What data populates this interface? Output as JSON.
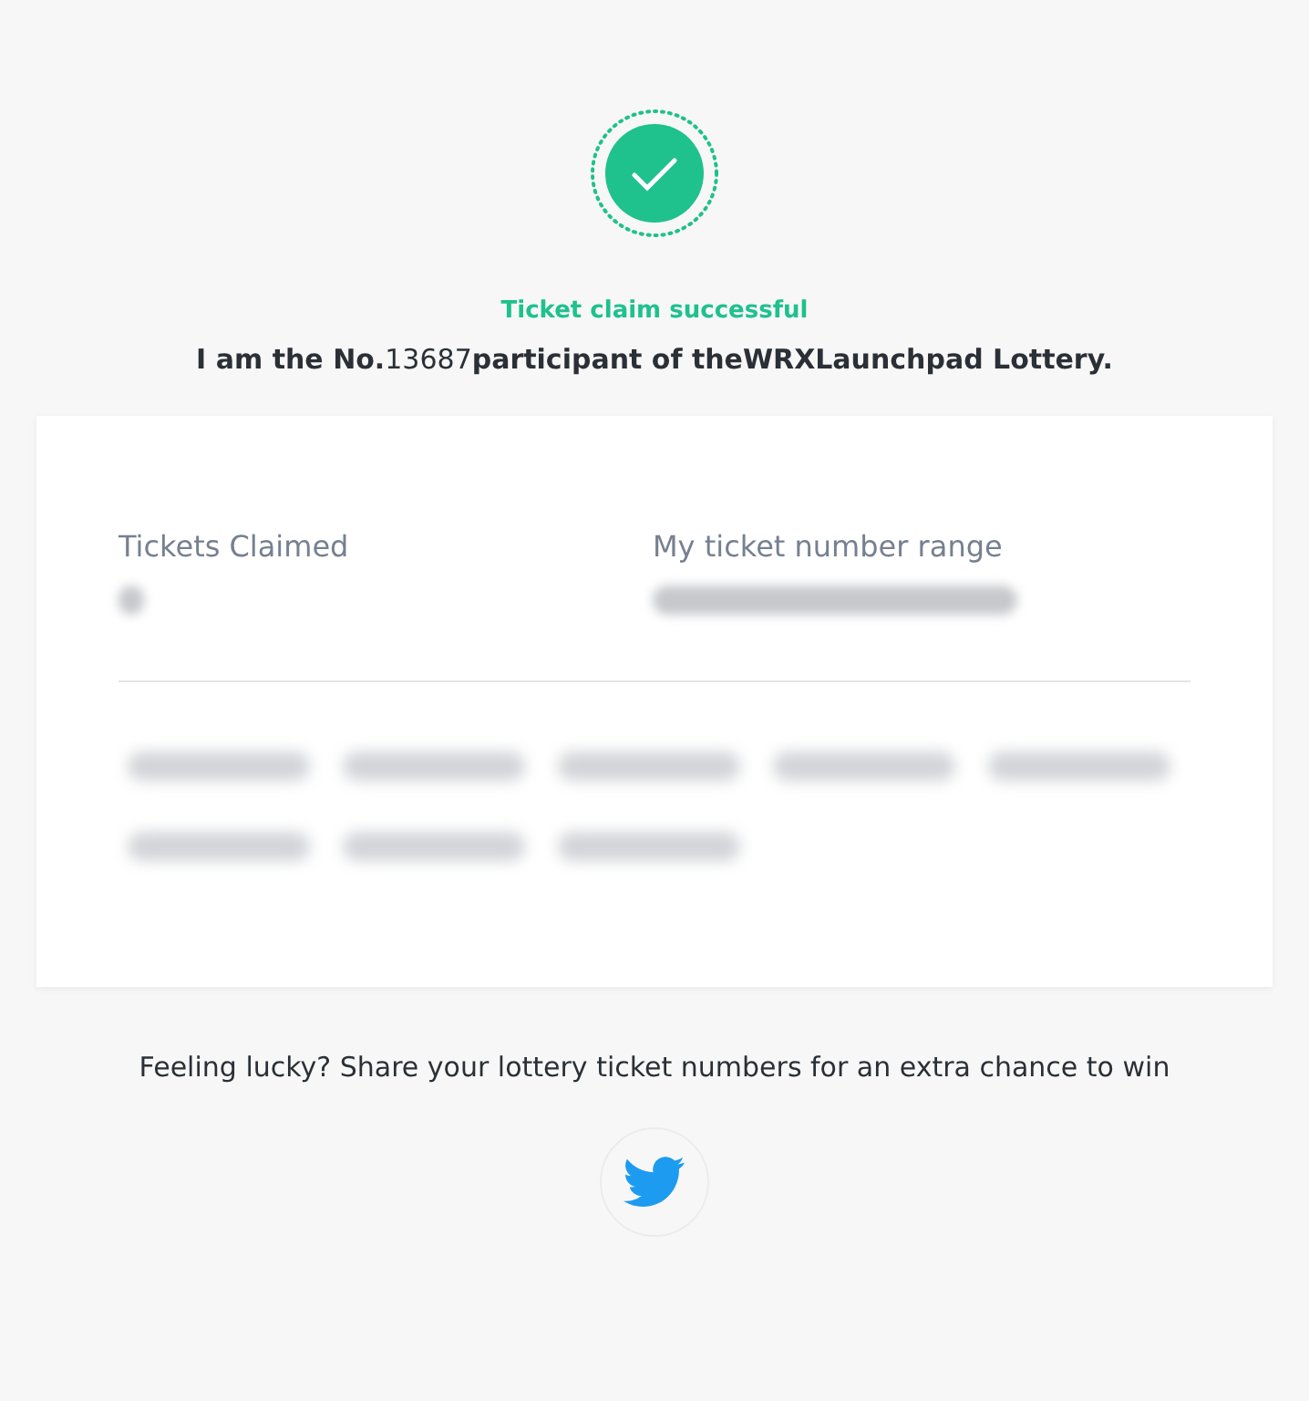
{
  "status": {
    "title": "Ticket claim successful",
    "message": "**I am the No.**13687**participant of theWRXLaunchpad Lottery.**"
  },
  "summary": [
    {
      "label": "Tickets Claimed",
      "value": {
        "kind": "redacted"
      }
    },
    {
      "label": "My ticket number range",
      "value": {
        "kind": "redacted"
      }
    }
  ],
  "tickets": [
    {
      "kind": "redacted"
    },
    {
      "kind": "redacted"
    },
    {
      "kind": "redacted"
    },
    {
      "kind": "redacted"
    },
    {
      "kind": "redacted"
    },
    {
      "kind": "redacted"
    },
    {
      "kind": "redacted"
    },
    {
      "kind": "redacted"
    }
  ],
  "share": {
    "text": "Feeling lucky? Share your lottery ticket numbers for an extra chance to win"
  }
}
